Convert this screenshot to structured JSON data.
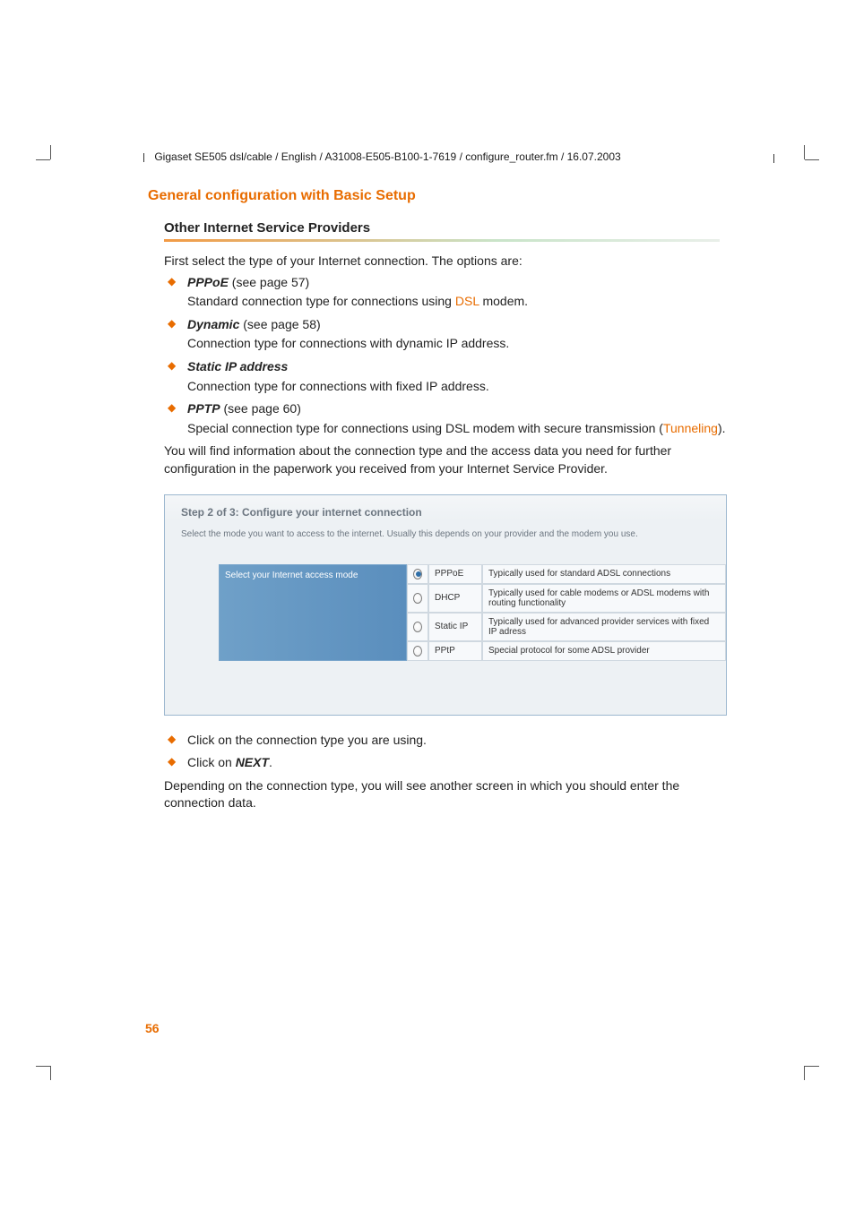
{
  "crop_marks": true,
  "running_head": "Gigaset SE505 dsl/cable / English / A31008-E505-B100-1-7619 / configure_router.fm / 16.07.2003",
  "section_title": "General configuration with Basic Setup",
  "subsection_title": "Other Internet Service Providers",
  "intro_line": "First select the type of your Internet connection. The options are:",
  "options": [
    {
      "term": "PPPoE",
      "paren": " (see page 57)",
      "desc_prefix": "Standard connection type for connections using ",
      "desc_link": "DSL",
      "desc_suffix": " modem."
    },
    {
      "term": "Dynamic",
      "paren": " (see page 58)",
      "desc_full": "Connection type for connections with dynamic IP address."
    },
    {
      "term": "Static IP address",
      "paren": "",
      "desc_full": "Connection type for connections with fixed IP address."
    },
    {
      "term": "PPTP",
      "paren": " (see page 60)",
      "desc_prefix": "Special connection type for connections using DSL modem with secure transmission (",
      "desc_link": "Tunneling",
      "desc_suffix": ")."
    }
  ],
  "paragraph_after_options": "You will find information about the connection type and the access data you need for further configuration in the paperwork you received from your Internet Service Provider.",
  "wizard": {
    "title": "Step 2 of 3: Configure your internet connection",
    "subtitle": "Select the mode you want to access to the internet. Usually this depends on your provider and the modem you use.",
    "row_label": "Select your Internet access mode",
    "modes": [
      {
        "id": "PPPoE",
        "desc": "Typically used for standard ADSL connections",
        "selected": true
      },
      {
        "id": "DHCP",
        "desc": "Typically used for cable modems or ADSL modems with routing functionality",
        "selected": false
      },
      {
        "id": "Static IP",
        "desc": "Typically used for advanced provider services with fixed IP adress",
        "selected": false
      },
      {
        "id": "PPtP",
        "desc": "Special protocol for some ADSL provider",
        "selected": false
      }
    ]
  },
  "post_steps": [
    "Click on the connection type you are using.",
    {
      "prefix": "Click on ",
      "bold": "NEXT",
      "suffix": "."
    }
  ],
  "closing_paragraph": "Depending on the connection type, you will see another screen in which you should enter the connection data.",
  "page_number": "56"
}
